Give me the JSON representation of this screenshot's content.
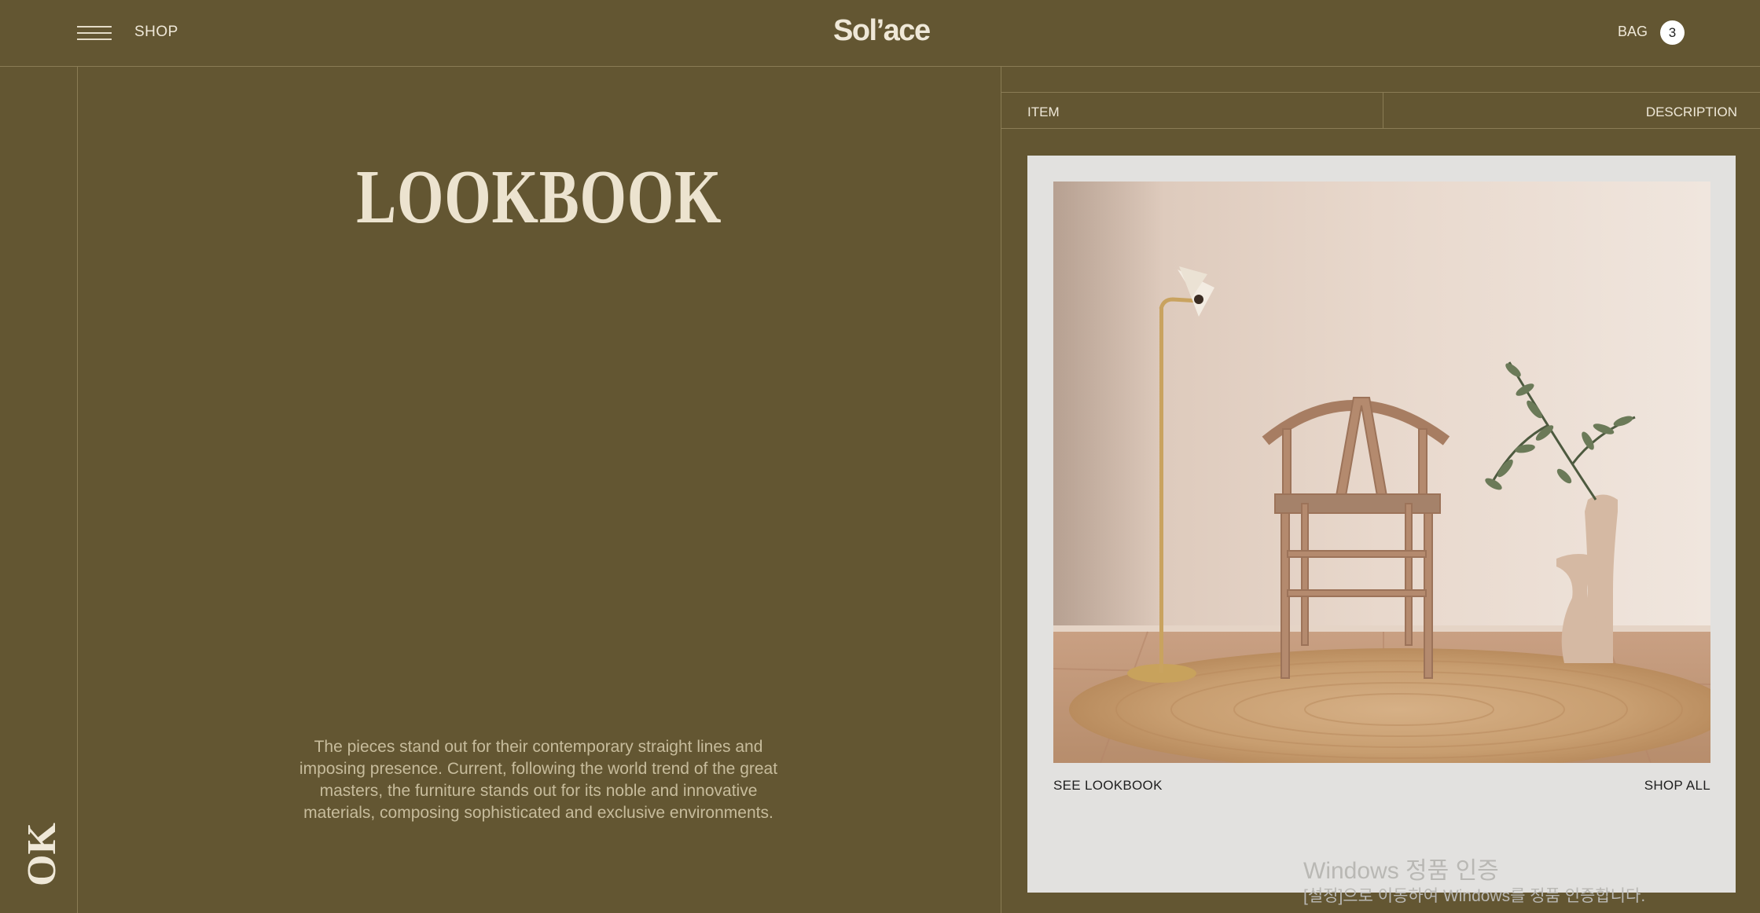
{
  "header": {
    "menu_icon": "hamburger-icon",
    "shop_label": "SHOP",
    "logo": "Sol’ace",
    "bag_label": "BAG",
    "bag_count": "3"
  },
  "side": {
    "vertical_text": "OK"
  },
  "main": {
    "title": "LOOKBOOK",
    "description": "The pieces stand out for their contemporary straight lines and imposing presence. Current, following the world trend of the great masters, the furniture stands out for its noble and innovative materials, composing sophisticated and exclusive environments."
  },
  "panel": {
    "tab_item": "ITEM",
    "tab_description": "DESCRIPTION",
    "see_lookbook": "SEE LOOKBOOK",
    "shop_all": "SHOP ALL"
  },
  "watermark": {
    "title": "Windows 정품 인증",
    "subtitle": "[설정]으로 이동하여 Windows를 정품 인증합니다."
  },
  "colors": {
    "background": "#635632",
    "text_light": "#efe8d8",
    "card_bg": "#e2e1df"
  }
}
